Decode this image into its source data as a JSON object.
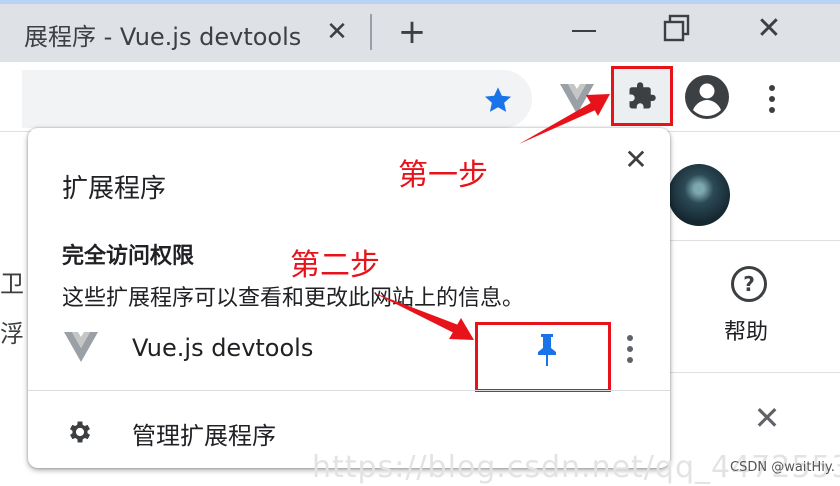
{
  "browser": {
    "tab_title": "展程序 - Vue.js devtools",
    "tab_close": "✕",
    "new_tab": "+",
    "window_close": "✕"
  },
  "page": {
    "help_label": "帮助",
    "help_symbol": "?",
    "close_symbol": "✕",
    "left_fragment_1": "卫",
    "left_fragment_2": "浮",
    "watermark": "https://blog.csdn.net/qq_44725531",
    "csdn_credit": "CSDN @waitHiy."
  },
  "popup": {
    "title": "扩展程序",
    "close": "✕",
    "section_title": "完全访问权限",
    "section_desc": "这些扩展程序可以查看和更改此网站上的信息。",
    "extension_name": "Vue.js devtools",
    "manage_label": "管理扩展程序"
  },
  "annotations": {
    "step1": "第一步",
    "step2": "第二步"
  },
  "icons": [
    "star-icon",
    "vue-extension-icon",
    "puzzle-icon",
    "avatar-icon",
    "menu-dots-icon",
    "pin-icon",
    "gear-icon",
    "help-icon",
    "close-icon"
  ],
  "colors": {
    "accent_blue": "#1a73e8",
    "annotation_red": "#e8131a",
    "vue_grey": "#9aa0a6",
    "tabbar_grey": "#dee1e6"
  }
}
